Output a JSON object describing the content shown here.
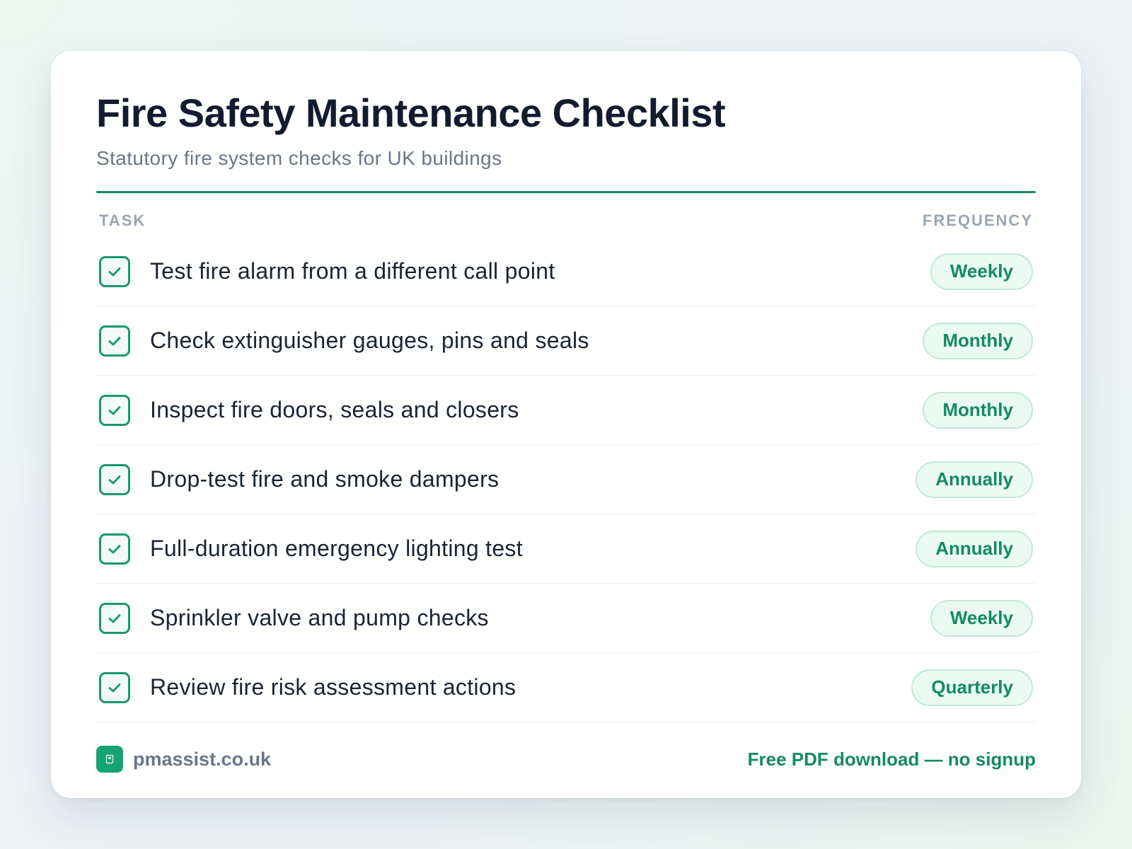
{
  "header": {
    "title": "Fire Safety Maintenance Checklist",
    "subtitle": "Statutory fire system checks for UK buildings"
  },
  "columns": {
    "task": "TASK",
    "frequency": "FREQUENCY"
  },
  "tasks": [
    {
      "label": "Test fire alarm from a different call point",
      "frequency": "Weekly",
      "checked": true
    },
    {
      "label": "Check extinguisher gauges, pins and seals",
      "frequency": "Monthly",
      "checked": true
    },
    {
      "label": "Inspect fire doors, seals and closers",
      "frequency": "Monthly",
      "checked": true
    },
    {
      "label": "Drop-test fire and smoke dampers",
      "frequency": "Annually",
      "checked": true
    },
    {
      "label": "Full-duration emergency lighting test",
      "frequency": "Annually",
      "checked": true
    },
    {
      "label": "Sprinkler valve and pump checks",
      "frequency": "Weekly",
      "checked": true
    },
    {
      "label": "Review fire risk assessment actions",
      "frequency": "Quarterly",
      "checked": true
    }
  ],
  "footer": {
    "brand": "pmassist.co.uk",
    "brand_icon": "building-icon",
    "cta": "Free PDF download — no signup"
  },
  "colors": {
    "accent": "#148a63",
    "badge_bg": "#eafaf2",
    "badge_border": "#bfe9d6",
    "title": "#131b2e",
    "muted": "#6b7687"
  }
}
